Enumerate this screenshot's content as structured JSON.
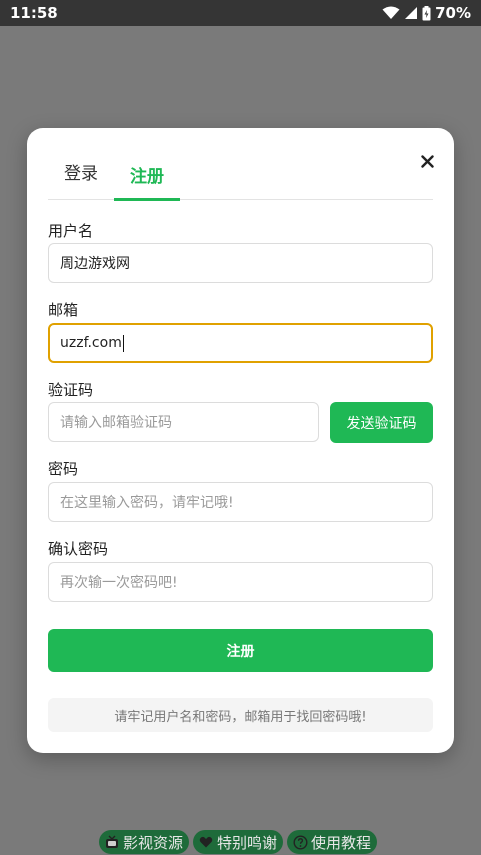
{
  "status_bar": {
    "time": "11:58",
    "battery": "70%",
    "icons": [
      "wifi-icon",
      "signal-icon",
      "battery-icon"
    ]
  },
  "tabs": [
    {
      "label": "登录",
      "active": false
    },
    {
      "label": "注册",
      "active": true
    }
  ],
  "form": {
    "username": {
      "label": "用户名",
      "value": "周边游戏网"
    },
    "email": {
      "label": "邮箱",
      "value": "uzzf.com"
    },
    "code": {
      "label": "验证码",
      "placeholder": "请输入邮箱验证码",
      "button": "发送验证码"
    },
    "password": {
      "label": "密码",
      "placeholder": "在这里输入密码，请牢记哦!"
    },
    "confirm": {
      "label": "确认密码",
      "placeholder": "再次输一次密码吧!"
    },
    "submit": "注册",
    "tip": "请牢记用户名和密码，邮箱用于找回密码哦!"
  },
  "bottom_nav": [
    {
      "label": "影视资源",
      "icon": "tv-icon"
    },
    {
      "label": "特别鸣谢",
      "icon": "heart-icon"
    },
    {
      "label": "使用教程",
      "icon": "help-icon"
    }
  ],
  "colors": {
    "accent": "#1fb855",
    "focus_border": "#e0a100",
    "overlay": "#7a7a7a"
  }
}
